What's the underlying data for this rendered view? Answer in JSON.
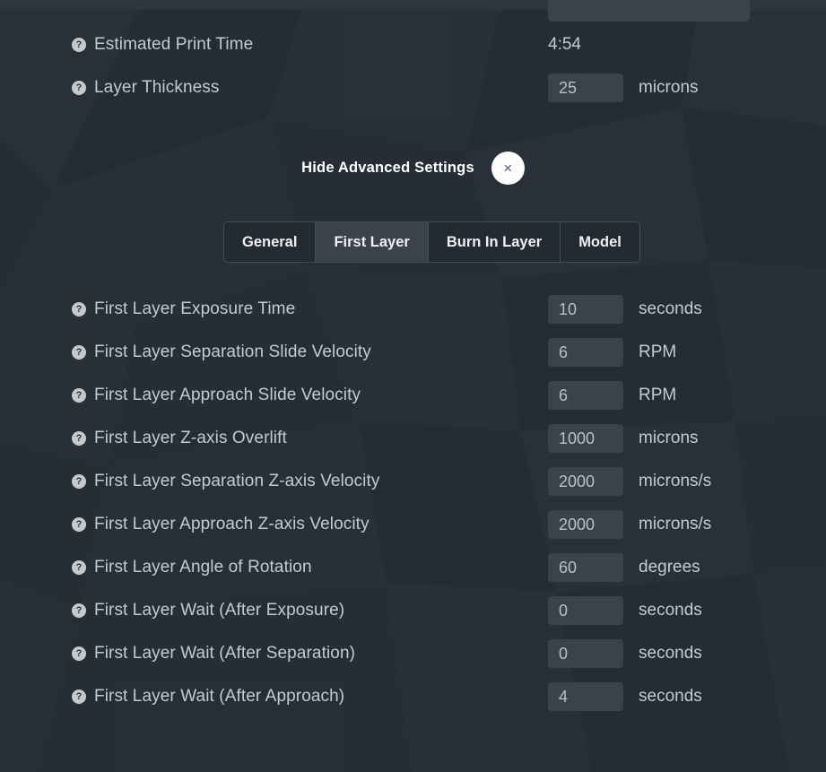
{
  "theme": {
    "background": "#272e36",
    "input_background": "#3a424c",
    "label_color": "#c3cbd2",
    "accent_white": "#ffffff",
    "tab_active_background": "#3b424b",
    "tab_inactive_background": "#242a32",
    "tab_border": "#454d57",
    "close_button_background": "#fdfdfd",
    "close_button_glyph": "#5b5a72",
    "help_icon_background": "#c6c9cc"
  },
  "help_icon_glyph": "?",
  "top_section": {
    "rows": [
      {
        "help_icon": "help-circle-icon",
        "label": "Estimated Print Time",
        "value": "4:54",
        "unit": "",
        "type": "static"
      },
      {
        "help_icon": "help-circle-icon",
        "label": "Layer Thickness",
        "value": "25",
        "unit": "microns",
        "type": "input"
      }
    ]
  },
  "advanced": {
    "toggle_label": "Hide Advanced Settings",
    "close_icon": "close-x-icon",
    "close_glyph": "×"
  },
  "tabs": {
    "items": [
      {
        "label": "General",
        "active": false
      },
      {
        "label": "First Layer",
        "active": true
      },
      {
        "label": "Burn In Layer",
        "active": false
      },
      {
        "label": "Model",
        "active": false
      }
    ],
    "selected": "First Layer"
  },
  "settings": {
    "rows": [
      {
        "help_icon": "help-circle-icon",
        "label": "First Layer Exposure Time",
        "value": "10",
        "unit": "seconds"
      },
      {
        "help_icon": "help-circle-icon",
        "label": "First Layer Separation Slide Velocity",
        "value": "6",
        "unit": "RPM"
      },
      {
        "help_icon": "help-circle-icon",
        "label": "First Layer Approach Slide Velocity",
        "value": "6",
        "unit": "RPM"
      },
      {
        "help_icon": "help-circle-icon",
        "label": "First Layer Z-axis Overlift",
        "value": "1000",
        "unit": "microns"
      },
      {
        "help_icon": "help-circle-icon",
        "label": "First Layer Separation Z-axis Velocity",
        "value": "2000",
        "unit": "microns/s"
      },
      {
        "help_icon": "help-circle-icon",
        "label": "First Layer Approach Z-axis Velocity",
        "value": "2000",
        "unit": "microns/s"
      },
      {
        "help_icon": "help-circle-icon",
        "label": "First Layer Angle of Rotation",
        "value": "60",
        "unit": "degrees"
      },
      {
        "help_icon": "help-circle-icon",
        "label": "First Layer Wait (After Exposure)",
        "value": "0",
        "unit": "seconds"
      },
      {
        "help_icon": "help-circle-icon",
        "label": "First Layer Wait (After Separation)",
        "value": "0",
        "unit": "seconds"
      },
      {
        "help_icon": "help-circle-icon",
        "label": "First Layer Wait (After Approach)",
        "value": "4",
        "unit": "seconds"
      }
    ]
  }
}
